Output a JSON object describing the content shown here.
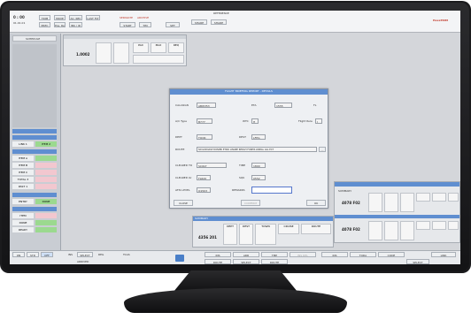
{
  "topbar": {
    "time": "0 : 00",
    "date": "01.01.01",
    "tabs_row1": [
      "TRIM",
      "MOVE",
      "AC. REC",
      "LAST FLT"
    ],
    "tabs_row2": [
      "PREC",
      "Pos. Rep",
      "INS / ID"
    ],
    "mid_labels": [
      "SEPARATE",
      "ARCHIVE"
    ],
    "mid_btns": [
      "START",
      "TIM",
      "SET"
    ],
    "right_label": "REFERENCE",
    "right_btns": [
      "SHARE",
      "SHARE"
    ],
    "logo": "HexaTRIM"
  },
  "sidebar": {
    "header": "SCHEDULE",
    "items_a": [
      "LINK 1",
      "ITEM 2"
    ],
    "items_b": [
      "ITEM A",
      "ITEM B",
      "ITEM C",
      "TOTAL 3",
      "PAST 1"
    ],
    "items_c": [
      "ENTRY",
      "DONE"
    ],
    "items_d": [
      "ITEM",
      "DONE",
      "READY"
    ]
  },
  "top_panel": {
    "flight_code": "1.0002",
    "col_headers": [
      "PAX",
      "MAX",
      "REQ"
    ]
  },
  "dialog": {
    "title": "FLIGHT BRIEFING REPORT - DETAILS",
    "fields": [
      {
        "label": "CALLSIGN",
        "value": "ABW353"
      },
      {
        "label": "A/C Type",
        "value": "B777"
      },
      {
        "label": "DEPT",
        "value": "TOOK"
      },
      {
        "label": "ROUTE",
        "value": "SN GODGDW DONIER ETIKO LINABE REDAH FOREIS LINBAL LGL ECT"
      },
      {
        "label": "CLEARED TO",
        "value": "SCOLT"
      },
      {
        "label": "CLEARED LV",
        "value": "FL620"
      },
      {
        "label": "ATIS LEVEL",
        "value": "O1503"
      }
    ],
    "fields_right": [
      {
        "label": "ETA",
        "value": "1555"
      },
      {
        "label": "WTC",
        "value": "H"
      },
      {
        "label": "DEST",
        "value": "LFPG"
      },
      {
        "label": "TIME",
        "value": "1800"
      },
      {
        "label": "SQK",
        "value": "0552"
      },
      {
        "label": "REMARKS",
        "value": ""
      }
    ],
    "fl_label": "FL",
    "flt_rule_label": "Flight Rule",
    "flt_rule_value": "I",
    "close_btn": "CLOSE",
    "confirm_btn": "CONFIRM",
    "ok_btn": "OK"
  },
  "bottom_left_panel": {
    "header": "SUMMARY",
    "code": "4356 201",
    "col_headers": [
      "DEPT",
      "DEST",
      "TOWN",
      "CRUISE",
      "ROUTE"
    ]
  },
  "right_panel": {
    "header": "SUMMARY",
    "code": "4078 F02",
    "code2": "4078 F02"
  },
  "bottom_bar": {
    "tabs": [
      "ON",
      "STD",
      "OFF"
    ],
    "labels": [
      "INS",
      "SELECT",
      "REG",
      "TCAS"
    ],
    "status": "ARRIVED",
    "buttons_a": [
      "INS",
      "ARR",
      "TMP",
      "INS DEL"
    ],
    "buttons_b": [
      "ROUTE",
      "SELECT",
      "ROUTE"
    ],
    "buttons_c": [
      "INS",
      "TODA",
      "CODE"
    ],
    "right_btns": [
      "SELECT",
      "LINK"
    ]
  }
}
